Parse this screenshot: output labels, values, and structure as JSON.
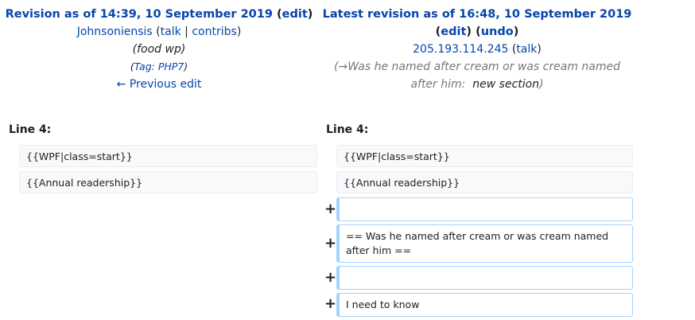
{
  "left": {
    "title_prefix": "Revision as of 14:39, 10 September 2019",
    "title_edit": "edit",
    "user": "Johnsoniensis",
    "user_talk": "talk",
    "user_contribs": "contribs",
    "summary": "(food wp)",
    "tag_label": "Tag:",
    "tag_value": "PHP7",
    "prev_edit": "← Previous edit",
    "line_label": "Line 4:"
  },
  "right": {
    "title": "Latest revision as of 16:48, 10 September 2019",
    "edit": "edit",
    "undo": "undo",
    "user": "205.193.114.245",
    "user_talk": "talk",
    "summary_arrow": "→",
    "summary_section": "Was he named after cream or was cream named after him:",
    "summary_text": "new section",
    "line_label": "Line 4:"
  },
  "diff": {
    "context_rows": [
      "{{WPF|class=start}}",
      "{{Annual readership}}"
    ],
    "added_rows": [
      "",
      "== Was he named after cream or was cream named after him ==",
      "",
      "I need to know"
    ],
    "add_marker": "+"
  }
}
